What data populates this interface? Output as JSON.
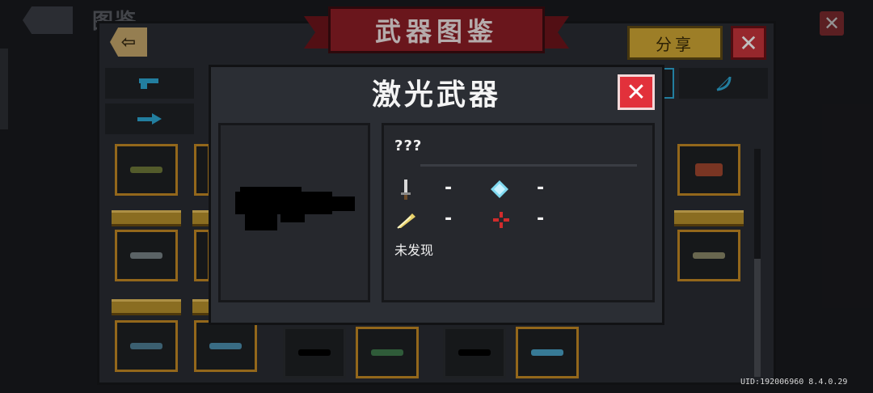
{
  "background": {
    "title": "图鉴"
  },
  "codex": {
    "banner_title": "武器图鉴",
    "share_label": "分享",
    "close_label": "✕",
    "back_label": "⇦"
  },
  "dialog": {
    "title": "激光武器",
    "close_label": "✕",
    "weapon_name": "???",
    "status": "未发现",
    "stats": {
      "damage": "-",
      "energy_cost": "-",
      "critical": "-",
      "accuracy": "-"
    }
  },
  "footer": {
    "version": "UID:192006960 8.4.0.29"
  },
  "colors": {
    "accent_gold": "#d2a834",
    "close_red": "#e2313b",
    "banner_red": "#8e1e26",
    "tab_icon_blue": "#2ea8d4"
  },
  "icons": {
    "damage": "sword-icon",
    "energy": "energy-crystal-icon",
    "critical": "feather-crit-icon",
    "accuracy": "crosshair-icon"
  }
}
